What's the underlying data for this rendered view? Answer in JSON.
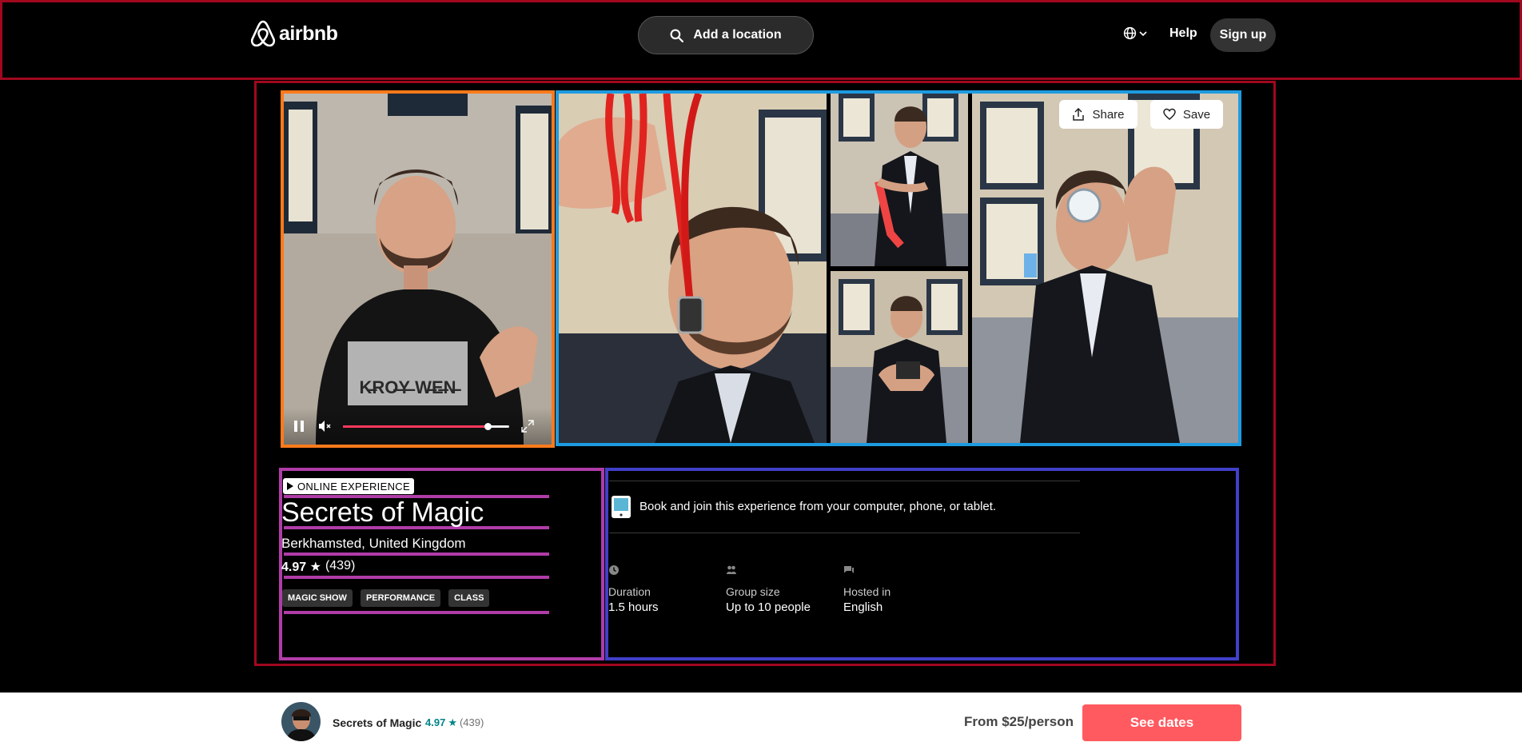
{
  "header": {
    "brand": "airbnb",
    "search_label": "Add a location",
    "help": "Help",
    "signup": "Sign up"
  },
  "gallery": {
    "share": "Share",
    "save": "Save",
    "video_progress_percent": 87
  },
  "experience": {
    "badge": "ONLINE EXPERIENCE",
    "title": "Secrets of Magic",
    "location": "Berkhamsted, United Kingdom",
    "rating": "4.97",
    "star": "★",
    "reviews": "(439)",
    "tags": [
      "MAGIC SHOW",
      "PERFORMANCE",
      "CLASS"
    ]
  },
  "details": {
    "book_text": "Book and join this experience from your computer, phone, or tablet.",
    "items": [
      {
        "icon": "clock-icon",
        "label": "Duration",
        "value": "1.5 hours"
      },
      {
        "icon": "people-icon",
        "label": "Group size",
        "value": "Up to 10 people"
      },
      {
        "icon": "chat-icon",
        "label": "Hosted in",
        "value": "English"
      }
    ]
  },
  "footer": {
    "title": "Secrets of Magic",
    "rating": "4.97",
    "star": "★",
    "reviews": "(439)",
    "price": "From $25/person",
    "cta": "See dates"
  },
  "colors": {
    "header_outline": "#a0081e",
    "video_outline": "#ff7a1a",
    "gallery_outline": "#1e9be0",
    "title_panel_outline": "#b03ca8",
    "details_panel_outline": "#4040c8",
    "cta": "#ff5a5f",
    "rating_accent": "#008489"
  }
}
